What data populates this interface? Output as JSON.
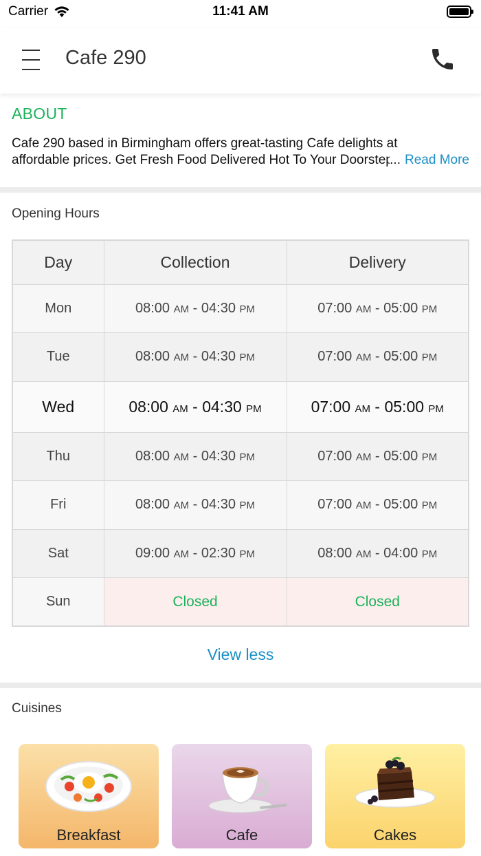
{
  "status_bar": {
    "carrier": "Carrier",
    "time": "11:41 AM"
  },
  "header": {
    "title": "Cafe 290",
    "menu_icon": "hamburger-menu-icon",
    "phone_icon": "phone-icon"
  },
  "about": {
    "title": "ABOUT",
    "line1": "Cafe 290 based in Birmingham offers great-tasting Cafe delights at",
    "line2": "affordable prices. Get Fresh Food Delivered Hot To Your Doorstep",
    "ellipsis": "...",
    "read_more": "Read More"
  },
  "opening_hours": {
    "label": "Opening Hours",
    "headers": [
      "Day",
      "Collection",
      "Delivery"
    ],
    "rows": [
      {
        "day": "Mon",
        "c_start": "08:00",
        "c_start_ap": "AM",
        "c_end": "04:30",
        "c_end_ap": "PM",
        "d_start": "07:00",
        "d_start_ap": "AM",
        "d_end": "05:00",
        "d_end_ap": "PM"
      },
      {
        "day": "Tue",
        "c_start": "08:00",
        "c_start_ap": "AM",
        "c_end": "04:30",
        "c_end_ap": "PM",
        "d_start": "07:00",
        "d_start_ap": "AM",
        "d_end": "05:00",
        "d_end_ap": "PM"
      },
      {
        "day": "Wed",
        "c_start": "08:00",
        "c_start_ap": "AM",
        "c_end": "04:30",
        "c_end_ap": "PM",
        "d_start": "07:00",
        "d_start_ap": "AM",
        "d_end": "05:00",
        "d_end_ap": "PM"
      },
      {
        "day": "Thu",
        "c_start": "08:00",
        "c_start_ap": "AM",
        "c_end": "04:30",
        "c_end_ap": "PM",
        "d_start": "07:00",
        "d_start_ap": "AM",
        "d_end": "05:00",
        "d_end_ap": "PM"
      },
      {
        "day": "Fri",
        "c_start": "08:00",
        "c_start_ap": "AM",
        "c_end": "04:30",
        "c_end_ap": "PM",
        "d_start": "07:00",
        "d_start_ap": "AM",
        "d_end": "05:00",
        "d_end_ap": "PM"
      },
      {
        "day": "Sat",
        "c_start": "09:00",
        "c_start_ap": "AM",
        "c_end": "02:30",
        "c_end_ap": "PM",
        "d_start": "08:00",
        "d_start_ap": "AM",
        "d_end": "04:00",
        "d_end_ap": "PM"
      },
      {
        "day": "Sun",
        "collection_closed": "Closed",
        "delivery_closed": "Closed"
      }
    ],
    "dash": "-",
    "view_less": "View less"
  },
  "cuisines": {
    "label": "Cuisines",
    "items": [
      {
        "name": "Breakfast",
        "icon": "breakfast-plate-icon",
        "color_top": "#fbe0a8",
        "color_bottom": "#f4b66a"
      },
      {
        "name": "Cafe",
        "icon": "coffee-cup-icon",
        "color_top": "#ead7ea",
        "color_bottom": "#d9acd3"
      },
      {
        "name": "Cakes",
        "icon": "cake-slice-icon",
        "color_top": "#fff0a3",
        "color_bottom": "#fbd36c"
      }
    ]
  },
  "colors": {
    "accent_green": "#1ab25a",
    "link_blue": "#1a8fc4",
    "closed_bg": "#fdeeee"
  }
}
